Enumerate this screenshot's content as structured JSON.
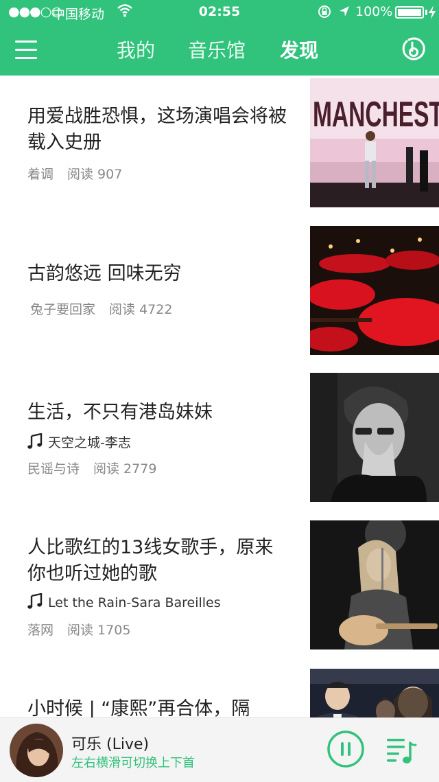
{
  "status_bar": {
    "signal": "●●●○○",
    "carrier": "中国移动",
    "time": "02:55",
    "battery": "100%",
    "battery_level": 1.0
  },
  "header": {
    "tabs": [
      {
        "label": "我的",
        "active": false
      },
      {
        "label": "音乐馆",
        "active": false
      },
      {
        "label": "发现",
        "active": true
      }
    ]
  },
  "feed": [
    {
      "title": "用爱战胜恐惧，这场演唱会将被载入史册",
      "song": "",
      "author": "着调",
      "reads": "阅读 907",
      "thumb_text": "MANCHEST"
    },
    {
      "title": "古韵悠远 回味无穷",
      "song": "",
      "author": "兔子要回家",
      "reads": "阅读 4722"
    },
    {
      "title": "生活，不只有港岛妹妹",
      "song": "天空之城-李志",
      "author": "民谣与诗",
      "reads": "阅读 2779"
    },
    {
      "title": "人比歌红的13线女歌手，原来你也听过她的歌",
      "song": "Let the Rain-Sara Bareilles",
      "author": "落网",
      "reads": "阅读 1705"
    },
    {
      "title": "小时候 | “康熙”再合体，隔",
      "song": "",
      "author": "",
      "reads": ""
    }
  ],
  "player": {
    "title": "可乐 (Live)",
    "hint": "左右横滑可切换上下首",
    "state": "playing"
  },
  "colors": {
    "brand": "#31c27c",
    "header_bg": "#31c27c",
    "hint_text": "#31c27c"
  }
}
